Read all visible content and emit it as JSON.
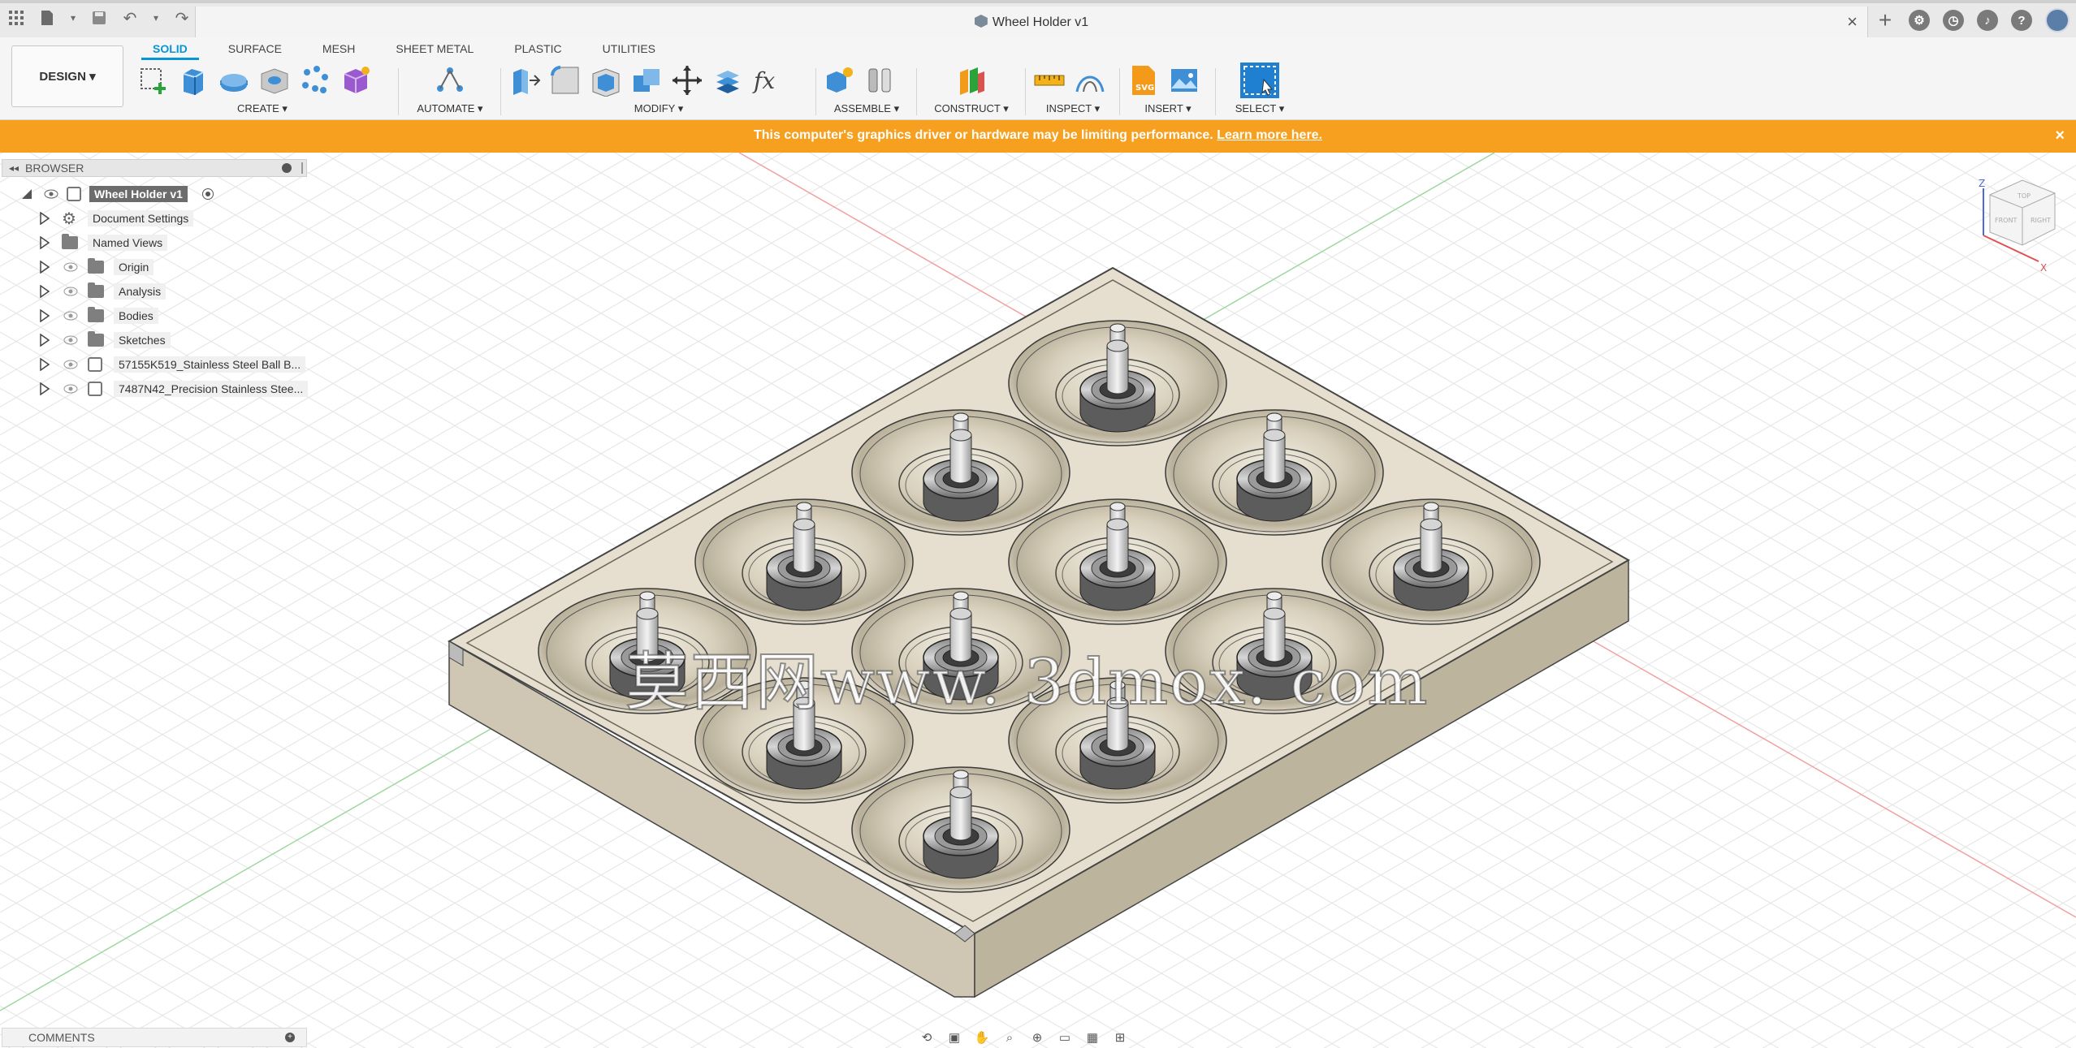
{
  "window": {
    "document_title": "Wheel Holder v1"
  },
  "toolbar": {
    "workspace": "DESIGN ▾",
    "tabs": [
      "SOLID",
      "SURFACE",
      "MESH",
      "SHEET METAL",
      "PLASTIC",
      "UTILITIES"
    ],
    "active_tab": "SOLID",
    "groups": {
      "create": "CREATE ▾",
      "automate": "AUTOMATE ▾",
      "modify": "MODIFY ▾",
      "assemble": "ASSEMBLE ▾",
      "construct": "CONSTRUCT ▾",
      "inspect": "INSPECT ▾",
      "insert": "INSERT ▾",
      "select": "SELECT ▾"
    }
  },
  "banner": {
    "message": "This computer's graphics driver or hardware may be limiting performance.",
    "link": "Learn more here.",
    "color": "#f7a01f"
  },
  "browser": {
    "title": "BROWSER",
    "root": "Wheel Holder v1",
    "items": [
      {
        "label": "Document Settings",
        "icon": "gear-icon"
      },
      {
        "label": "Named Views",
        "icon": "folder-icon"
      },
      {
        "label": "Origin",
        "icon": "folder-icon"
      },
      {
        "label": "Analysis",
        "icon": "folder-icon"
      },
      {
        "label": "Bodies",
        "icon": "folder-icon"
      },
      {
        "label": "Sketches",
        "icon": "folder-icon"
      },
      {
        "label": "57155K519_Stainless Steel Ball B...",
        "icon": "component-icon"
      },
      {
        "label": "7487N42_Precision Stainless Stee...",
        "icon": "component-icon"
      }
    ]
  },
  "viewcube": {
    "top": "TOP",
    "front": "FRONT",
    "right": "RIGHT",
    "axis_z": "Z",
    "axis_x": "X"
  },
  "comments": {
    "label": "COMMENTS"
  },
  "watermark": {
    "text": "莫西网www. 3dmox. com"
  },
  "colors": {
    "accent": "#0696d7",
    "plate": "#e6dfcf",
    "banner": "#f7a01f"
  }
}
